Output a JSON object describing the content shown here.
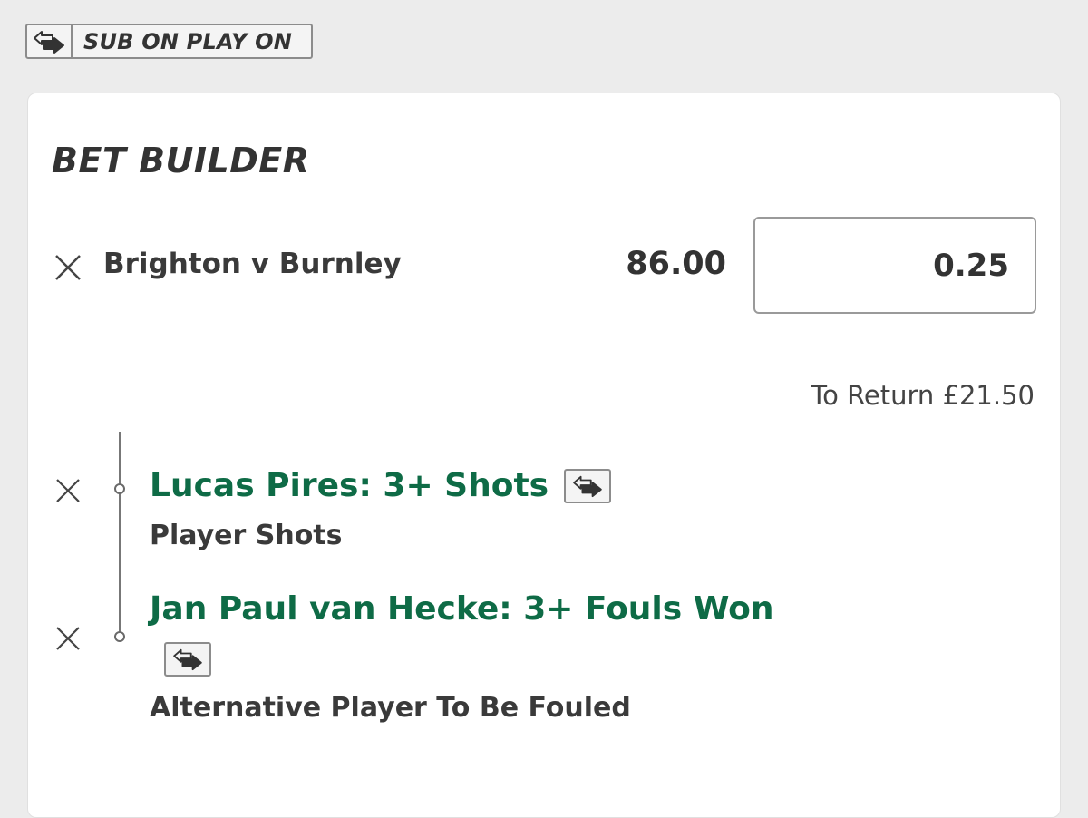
{
  "sub_on_play_on": {
    "label": "SUB ON PLAY ON",
    "icon": "swap-arrows-icon"
  },
  "bet_builder": {
    "title": "BET BUILDER",
    "match": "Brighton v Burnley",
    "odds": "86.00",
    "stake": "0.25",
    "to_return": "To Return £21.50",
    "selections": [
      {
        "title": "Lucas Pires: 3+ Shots",
        "market": "Player Shots",
        "icon": "swap-arrows-icon"
      },
      {
        "title": "Jan Paul van Hecke: 3+ Fouls Won",
        "market": "Alternative Player To Be Fouled",
        "icon": "swap-arrows-icon"
      }
    ]
  },
  "colors": {
    "selection_green": "#0e6b46",
    "text_dark": "#333333",
    "background": "#ececec"
  }
}
